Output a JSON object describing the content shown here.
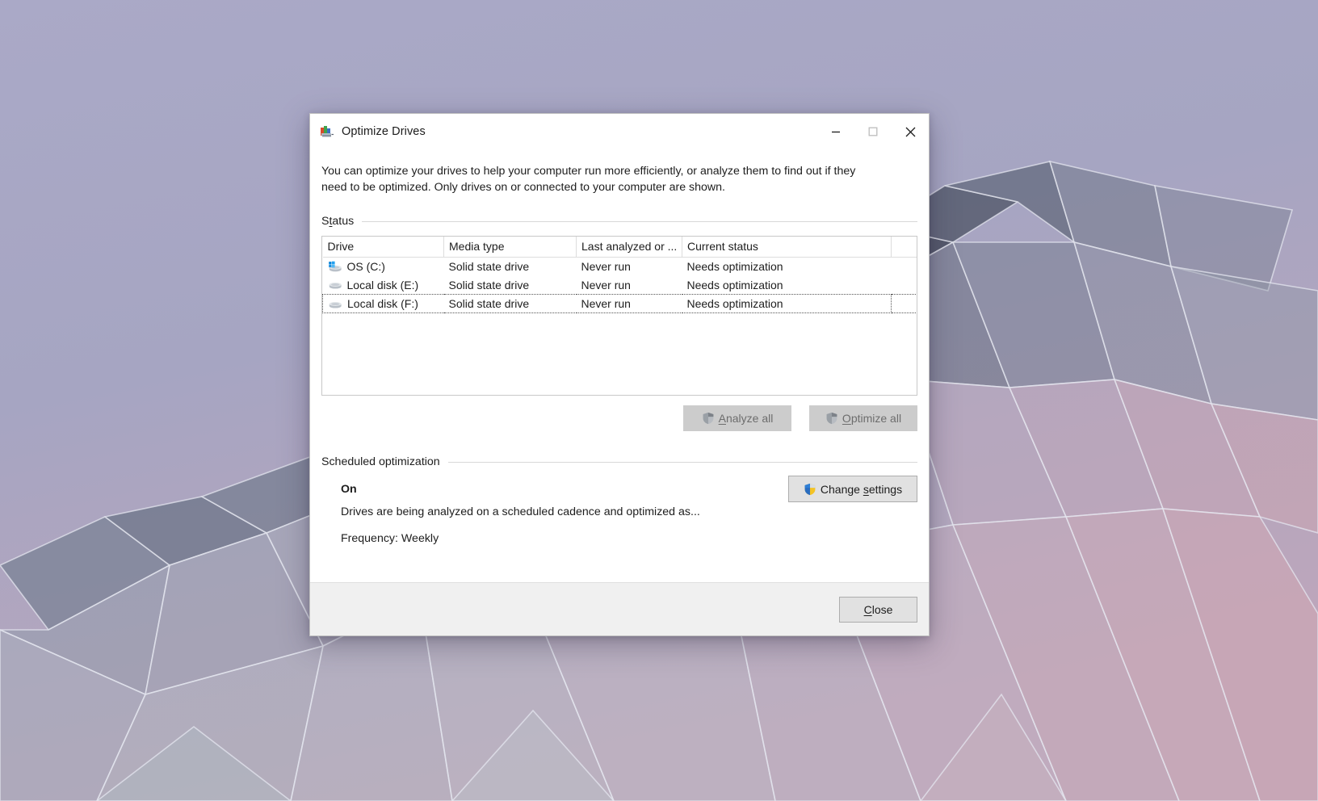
{
  "window": {
    "title": "Optimize Drives",
    "app_icon": "optimize-drives-icon",
    "controls": {
      "minimize": "minimize-icon",
      "maximize": "maximize-icon",
      "close": "close-icon"
    }
  },
  "intro": "You can optimize your drives to help your computer run more efficiently, or analyze them to find out if they need to be optimized. Only drives on or connected to your computer are shown.",
  "status_section": {
    "label": "Status",
    "label_accesskey": "t",
    "columns": [
      "Drive",
      "Media type",
      "Last analyzed or ...",
      "Current status",
      ""
    ],
    "rows": [
      {
        "icon": "windows-drive-icon",
        "drive": "OS (C:)",
        "media_type": "Solid state drive",
        "last_analyzed": "Never run",
        "current_status": "Needs optimization",
        "focused": false
      },
      {
        "icon": "drive-icon",
        "drive": "Local disk (E:)",
        "media_type": "Solid state drive",
        "last_analyzed": "Never run",
        "current_status": "Needs optimization",
        "focused": false
      },
      {
        "icon": "drive-icon",
        "drive": "Local disk (F:)",
        "media_type": "Solid state drive",
        "last_analyzed": "Never run",
        "current_status": "Needs optimization",
        "focused": true
      }
    ]
  },
  "buttons": {
    "analyze_all": "Analyze all",
    "analyze_all_accesskey": "A",
    "analyze_all_enabled": false,
    "optimize_all": "Optimize all",
    "optimize_all_accesskey": "O",
    "optimize_all_enabled": false,
    "change_settings": "Change settings",
    "change_settings_accesskey": "s",
    "change_settings_enabled": true,
    "close": "Close",
    "close_accesskey": "C"
  },
  "scheduled_section": {
    "label": "Scheduled optimization",
    "state": "On",
    "description": "Drives are being analyzed on a scheduled cadence and optimized as...",
    "frequency": "Frequency: Weekly"
  },
  "colors": {
    "shield_blue": "#2a6dc0",
    "shield_yellow": "#f4c324",
    "shield_gray": "#9aa0a6",
    "window_bg": "#ffffff",
    "footer_bg": "#f0f0f0",
    "text": "#1d1d1d",
    "disabled_text": "#6d6d6d",
    "accent_hover": "#0078d7"
  }
}
